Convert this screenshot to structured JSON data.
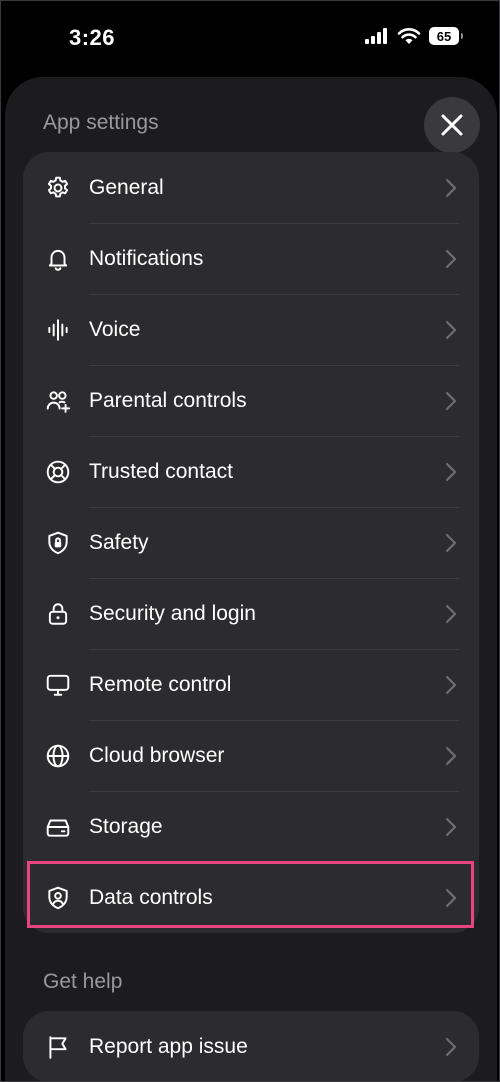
{
  "status_bar": {
    "time": "3:26",
    "battery": "65"
  },
  "app_settings": {
    "title": "App settings",
    "items": [
      {
        "label": "General",
        "icon": "gear-icon"
      },
      {
        "label": "Notifications",
        "icon": "bell-icon"
      },
      {
        "label": "Voice",
        "icon": "voice-waveform-icon"
      },
      {
        "label": "Parental controls",
        "icon": "people-plus-icon"
      },
      {
        "label": "Trusted contact",
        "icon": "lifebuoy-icon"
      },
      {
        "label": "Safety",
        "icon": "shield-lock-icon"
      },
      {
        "label": "Security and login",
        "icon": "lock-icon"
      },
      {
        "label": "Remote control",
        "icon": "monitor-icon"
      },
      {
        "label": "Cloud browser",
        "icon": "globe-icon"
      },
      {
        "label": "Storage",
        "icon": "drive-icon"
      },
      {
        "label": "Data controls",
        "icon": "shield-person-icon"
      }
    ]
  },
  "get_help": {
    "title": "Get help",
    "items": [
      {
        "label": "Report app issue",
        "icon": "flag-icon"
      }
    ]
  },
  "highlight_color": "#e8457c"
}
